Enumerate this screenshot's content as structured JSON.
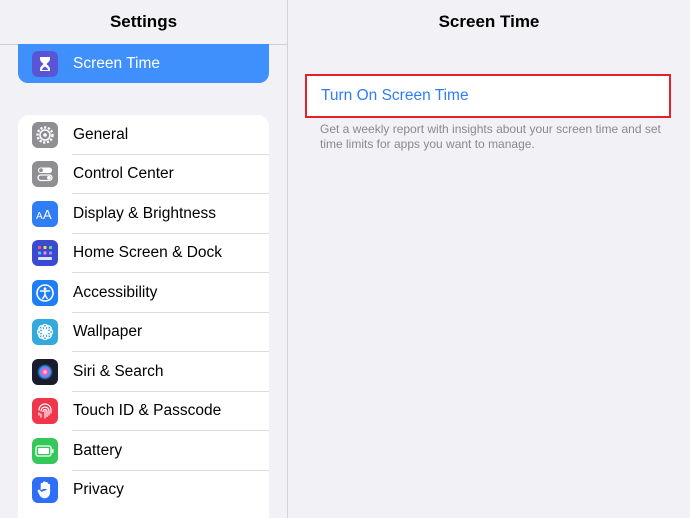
{
  "left_header": {
    "title": "Settings"
  },
  "selected_item": {
    "label": "Screen Time",
    "icon": "hourglass-icon",
    "color": "#5856d6"
  },
  "settings_items": [
    {
      "label": "General",
      "icon": "gear-icon",
      "color": "#8e8e93"
    },
    {
      "label": "Control Center",
      "icon": "toggles-icon",
      "color": "#8e8e93"
    },
    {
      "label": "Display & Brightness",
      "icon": "text-size-icon",
      "color": "#2f7ef6"
    },
    {
      "label": "Home Screen & Dock",
      "icon": "app-grid-icon",
      "color": "#3b4bd1"
    },
    {
      "label": "Accessibility",
      "icon": "accessibility-icon",
      "color": "#1f7ef6"
    },
    {
      "label": "Wallpaper",
      "icon": "flower-icon",
      "color": "#34aadc"
    },
    {
      "label": "Siri & Search",
      "icon": "siri-icon",
      "color": "#1b1b2e"
    },
    {
      "label": "Touch ID & Passcode",
      "icon": "fingerprint-icon",
      "color": "#f0364b"
    },
    {
      "label": "Battery",
      "icon": "battery-icon",
      "color": "#34c759"
    },
    {
      "label": "Privacy",
      "icon": "hand-icon",
      "color": "#2f6ef6"
    }
  ],
  "right_header": {
    "title": "Screen Time"
  },
  "turn_on": {
    "label": "Turn On Screen Time",
    "highlight_color": "#e4202b"
  },
  "footer": {
    "text": "Get a weekly report with insights about your screen time and set time limits for apps you want to manage."
  }
}
